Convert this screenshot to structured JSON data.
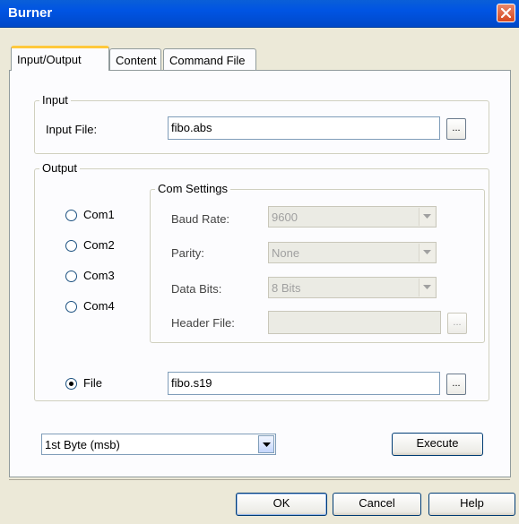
{
  "window": {
    "title": "Burner",
    "close_icon": "close-icon"
  },
  "tabs": [
    {
      "label": "Input/Output",
      "active": true
    },
    {
      "label": "Content",
      "active": false
    },
    {
      "label": "Command File",
      "active": false
    }
  ],
  "input_group": {
    "legend": "Input",
    "input_file_label": "Input File:",
    "input_file_value": "fibo.abs",
    "browse_label": "..."
  },
  "output_group": {
    "legend": "Output",
    "radios": [
      {
        "label": "Com1",
        "checked": false
      },
      {
        "label": "Com2",
        "checked": false
      },
      {
        "label": "Com3",
        "checked": false
      },
      {
        "label": "Com4",
        "checked": false
      }
    ],
    "com_settings": {
      "legend": "Com Settings",
      "baud_rate_label": "Baud Rate:",
      "baud_rate_value": "9600",
      "parity_label": "Parity:",
      "parity_value": "None",
      "data_bits_label": "Data Bits:",
      "data_bits_value": "8 Bits",
      "header_file_label": "Header File:",
      "header_file_value": "",
      "browse_label": "..."
    },
    "file_radio": {
      "label": "File",
      "checked": true
    },
    "file_value": "fibo.s19",
    "file_browse_label": "..."
  },
  "byte_order_select": {
    "value": "1st Byte (msb)"
  },
  "buttons": {
    "execute": "Execute",
    "ok": "OK",
    "cancel": "Cancel",
    "help": "Help"
  },
  "colors": {
    "titlebar": "#0054e3",
    "tab_highlight": "#ffc83c",
    "dialog_bg": "#ece9d8"
  }
}
